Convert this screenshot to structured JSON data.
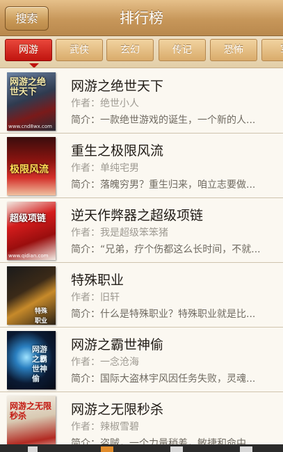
{
  "header": {
    "title": "排行榜",
    "search_label": "搜索"
  },
  "tabs": [
    "网游",
    "武侠",
    "玄幻",
    "传记",
    "恐怖",
    "军"
  ],
  "books": [
    {
      "title": "网游之绝世天下",
      "author": "作者：绝世小人",
      "intro": "简介：一款绝世游戏的诞生，一个新的人...",
      "cover_text": "网游之绝世天下",
      "cover_caption": "www.cnd8wx.com"
    },
    {
      "title": "重生之极限风流",
      "author": "作者：单纯宅男",
      "intro": "简介：落魄穷男？重生归来，咱立志要做...",
      "cover_text": "极限风流",
      "cover_caption": ""
    },
    {
      "title": "逆天作弊器之超级项链",
      "author": "作者：我是超级笨笨猪",
      "intro": "简介：“兄弟，疗个伤都这么长时间，不就...",
      "cover_text": "超级项链",
      "cover_caption": "www.qidian.com"
    },
    {
      "title": "特殊职业",
      "author": "作者：旧轩",
      "intro": "简介：什么是特殊职业？特殊职业就是比...",
      "cover_text": "特殊职业",
      "cover_caption": ""
    },
    {
      "title": "网游之霸世神偷",
      "author": "作者：一念沧海",
      "intro": "简介：国际大盗林宇风因任务失败，灵魂...",
      "cover_text": "网游之霸世神偷",
      "cover_caption": ""
    },
    {
      "title": "网游之无限秒杀",
      "author": "作者：辣椒雪碧",
      "intro": "简介：盗贼，一个力量稍差，敏捷和命中...",
      "cover_text": "网游之无限秒杀",
      "cover_caption": ""
    }
  ],
  "colors": {
    "header": "#c7975a",
    "active_tab": "#c0140f",
    "tab": "#d9ab6b",
    "background": "#f2ede2"
  }
}
